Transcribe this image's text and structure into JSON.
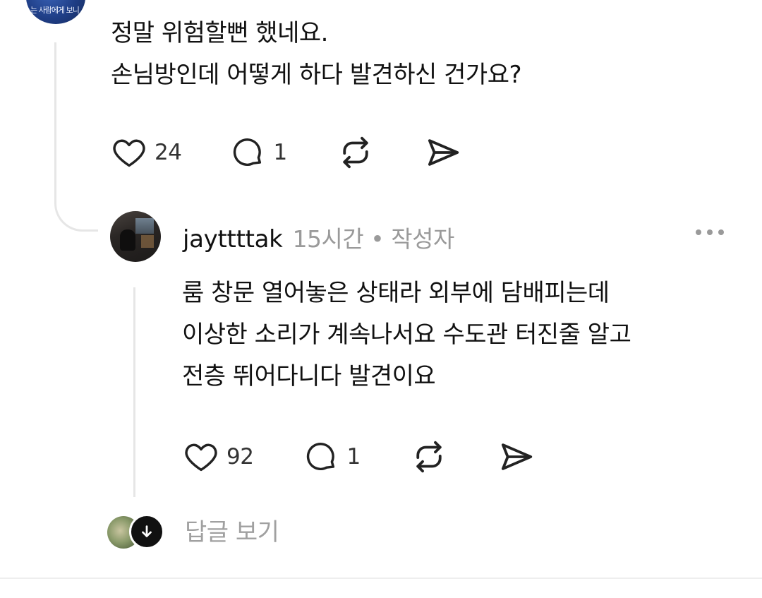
{
  "top_avatar": {
    "overlay_text": "는 사람에게 보니"
  },
  "parent_comment": {
    "lines": [
      "정말 위험할뻔 했네요.",
      "손님방인데 어떻게 하다 발견하신 건가요?"
    ],
    "likes": "24",
    "replies": "1"
  },
  "reply": {
    "username": "jayttttak",
    "meta": "15시간 • 작성자",
    "lines": [
      "룸 창문 열어놓은 상태라 외부에 담배피는데",
      "이상한 소리가 계속나서요 수도관 터진줄 알고",
      "전층 뛰어다니다 발견이요"
    ],
    "likes": "92",
    "replies": "1"
  },
  "see_replies_label": "답글 보기",
  "icons": {
    "like": "heart-icon",
    "comment": "comment-bubble-icon",
    "repost": "repost-icon",
    "share": "send-icon",
    "more": "more-dots-icon",
    "expand": "arrow-down-icon"
  }
}
